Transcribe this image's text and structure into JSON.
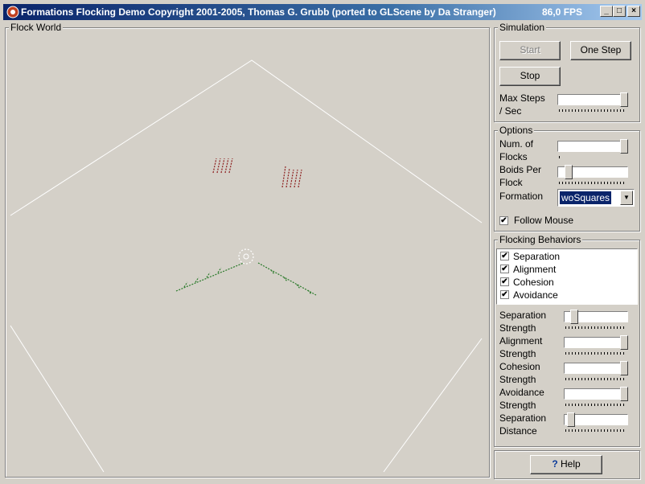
{
  "window": {
    "title": "Formations Flocking Demo   Copyright 2001-2005, Thomas G. Grubb (ported to GLScene by Da Stranger)",
    "fps": "86,0 FPS",
    "minimize_glyph": "_",
    "maximize_glyph": "□",
    "close_glyph": "×"
  },
  "world": {
    "caption": "Flock World"
  },
  "simulation": {
    "caption": "Simulation",
    "start_label": "Start",
    "one_step_label": "One Step",
    "stop_label": "Stop",
    "max_steps_line1": "Max Steps",
    "max_steps_line2": "/ Sec",
    "max_steps_level": 1.0
  },
  "options": {
    "caption": "Options",
    "num_flocks_line1": "Num. of",
    "num_flocks_line2": "Flocks",
    "num_flocks_level": 1.0,
    "boids_line1": "Boids Per",
    "boids_line2": "Flock",
    "boids_level": 0.12,
    "formation_label": "Formation",
    "formation_value": "woSquares",
    "follow_mouse_label": "Follow Mouse",
    "follow_mouse_checked": "✔"
  },
  "behaviors": {
    "caption": "Flocking Behaviors",
    "items": [
      {
        "label": "Separation",
        "check": "✔"
      },
      {
        "label": "Alignment",
        "check": "✔"
      },
      {
        "label": "Cohesion",
        "check": "✔"
      },
      {
        "label": "Avoidance",
        "check": "✔"
      }
    ]
  },
  "strengths": {
    "separation_line1": "Separation",
    "separation_line2": "Strength",
    "separation_level": 0.12,
    "alignment_line1": "Alignment",
    "alignment_line2": "Strength",
    "alignment_level": 1.0,
    "cohesion_line1": "Cohesion",
    "cohesion_line2": "Strength",
    "cohesion_level": 1.0,
    "avoidance_line1": "Avoidance",
    "avoidance_line2": "Strength",
    "avoidance_level": 1.0,
    "sep_distance_line1": "Separation",
    "sep_distance_line2": "Distance",
    "sep_distance_level": 0.05
  },
  "help": {
    "label": "Help",
    "icon_glyph": "?"
  }
}
